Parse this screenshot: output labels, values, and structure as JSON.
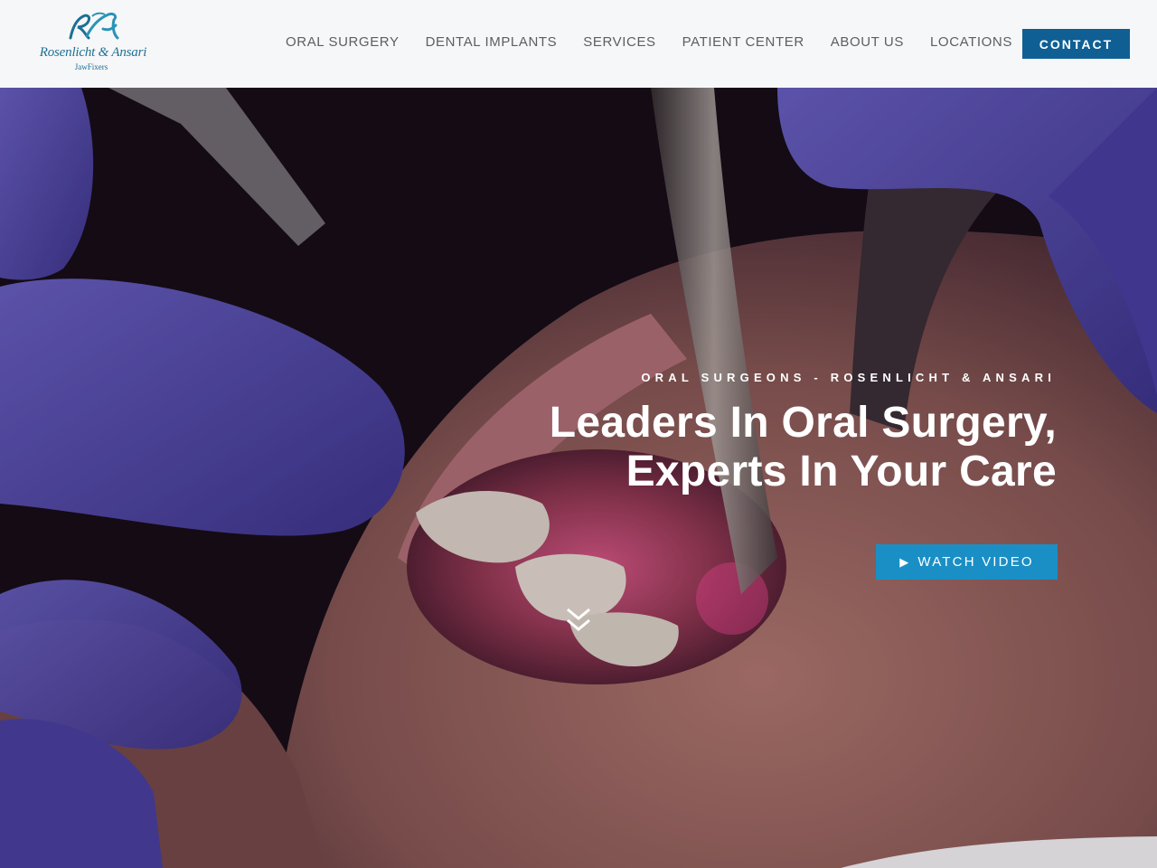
{
  "brand": {
    "name": "Rosenlicht & Ansari",
    "tagline": "JawFixers",
    "monogram": "RA",
    "color": "#1d6f94"
  },
  "nav": {
    "items": [
      {
        "label": "ORAL SURGERY"
      },
      {
        "label": "DENTAL IMPLANTS"
      },
      {
        "label": "SERVICES"
      },
      {
        "label": "PATIENT CENTER"
      },
      {
        "label": "ABOUT US"
      },
      {
        "label": "LOCATIONS"
      }
    ],
    "contact_label": "CONTACT",
    "contact_color": "#0f5f94"
  },
  "hero": {
    "eyebrow": "ORAL SURGEONS - ROSENLICHT & ANSARI",
    "headline_line1": "Leaders In Oral Surgery,",
    "headline_line2": "Experts In Your Care",
    "watch_label": "WATCH VIDEO",
    "watch_icon": "play-icon",
    "watch_color": "#1a8fc5",
    "scroll_icon": "double-chevron-down-icon"
  }
}
